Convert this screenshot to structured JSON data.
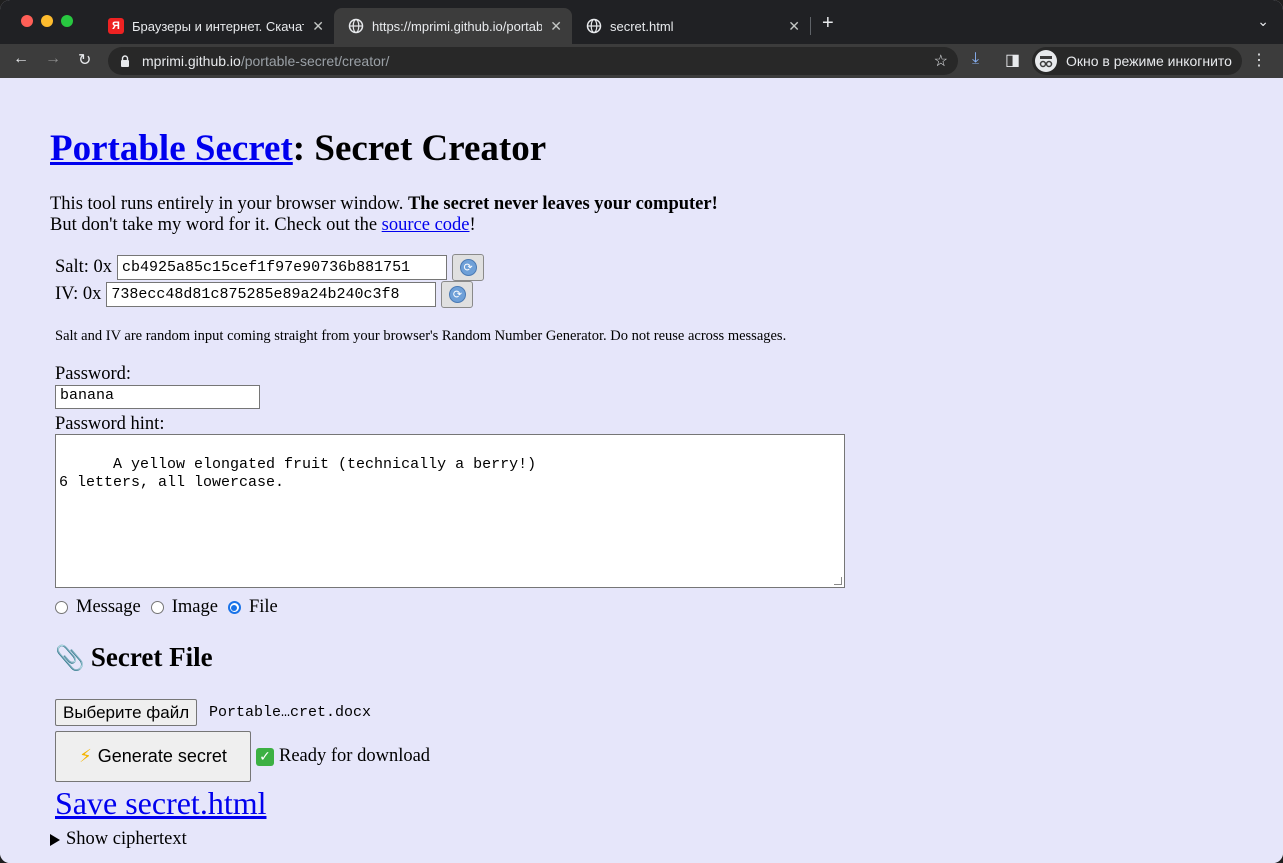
{
  "browser": {
    "tabs": [
      {
        "title": "Браузеры и интернет. Скачат",
        "active": false,
        "favicon": "yandex-icon"
      },
      {
        "title": "https://mprimi.github.io/portab",
        "active": true,
        "favicon": "globe-icon"
      },
      {
        "title": "secret.html",
        "active": false,
        "favicon": "globe-icon"
      }
    ],
    "url_host": "mprimi.github.io",
    "url_path": "/portable-secret/creator/",
    "incognito_label": "Окно в режиме инкогнито",
    "favicon_letter": "Я"
  },
  "page": {
    "title_link": "Portable Secret",
    "title_rest": ": Secret Creator",
    "intro_plain": "This tool runs entirely in your browser window. ",
    "intro_bold": "The secret never leaves your computer!",
    "intro_line2_pre": "But don't take my word for it. Check out the ",
    "intro_link": "source code",
    "intro_line2_post": "!",
    "salt_label": "Salt: 0x",
    "salt_value": "cb4925a85c15cef1f97e90736b881751",
    "iv_label": "IV: 0x",
    "iv_value": "738ecc48d81c875285e89a24b240c3f8",
    "note": "Salt and IV are random input coming straight from your browser's Random Number Generator. Do not reuse across messages.",
    "password_label": "Password:",
    "password_value": "banana",
    "hint_label": "Password hint:",
    "hint_value": "A yellow elongated fruit (technically a berry!)\n6 letters, all lowercase.",
    "radio_options": [
      {
        "label": "Message",
        "checked": false
      },
      {
        "label": "Image",
        "checked": false
      },
      {
        "label": "File",
        "checked": true
      }
    ],
    "section_title": "Secret File",
    "choose_file_label": "Выберите файл",
    "file_name": "Portable…cret.docx",
    "generate_label": "Generate secret",
    "status": "Ready for download",
    "save_link": "Save secret.html",
    "ciphertext_toggle": "Show ciphertext"
  }
}
